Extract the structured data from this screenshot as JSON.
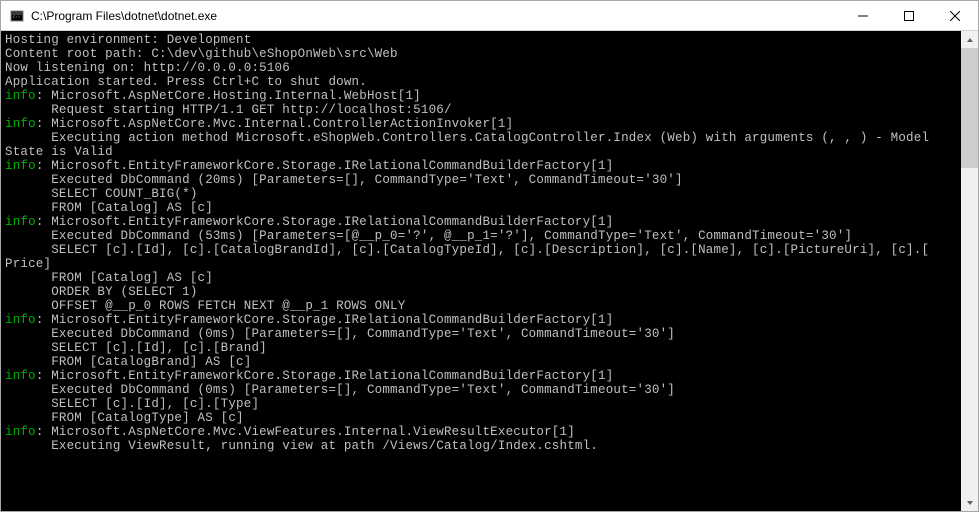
{
  "window": {
    "title": "C:\\Program Files\\dotnet\\dotnet.exe"
  },
  "log": {
    "l0": "Hosting environment: Development",
    "l1": "Content root path: C:\\dev\\github\\eShopOnWeb\\src\\Web",
    "l2": "Now listening on: http://0.0.0.0:5106",
    "l3": "Application started. Press Ctrl+C to shut down.",
    "i4": "info",
    "l4": ": Microsoft.AspNetCore.Hosting.Internal.WebHost[1]",
    "l5": "      Request starting HTTP/1.1 GET http://localhost:5106/",
    "i6": "info",
    "l6": ": Microsoft.AspNetCore.Mvc.Internal.ControllerActionInvoker[1]",
    "l7": "      Executing action method Microsoft.eShopWeb.Controllers.CatalogController.Index (Web) with arguments (, , ) - Model",
    "l8": "State is Valid",
    "i9": "info",
    "l9": ": Microsoft.EntityFrameworkCore.Storage.IRelationalCommandBuilderFactory[1]",
    "l10": "      Executed DbCommand (20ms) [Parameters=[], CommandType='Text', CommandTimeout='30']",
    "l11": "      SELECT COUNT_BIG(*)",
    "l12": "      FROM [Catalog] AS [c]",
    "i13": "info",
    "l13": ": Microsoft.EntityFrameworkCore.Storage.IRelationalCommandBuilderFactory[1]",
    "l14": "      Executed DbCommand (53ms) [Parameters=[@__p_0='?', @__p_1='?'], CommandType='Text', CommandTimeout='30']",
    "l15": "      SELECT [c].[Id], [c].[CatalogBrandId], [c].[CatalogTypeId], [c].[Description], [c].[Name], [c].[PictureUri], [c].[",
    "l16": "Price]",
    "l17": "      FROM [Catalog] AS [c]",
    "l18": "      ORDER BY (SELECT 1)",
    "l19": "      OFFSET @__p_0 ROWS FETCH NEXT @__p_1 ROWS ONLY",
    "i20": "info",
    "l20": ": Microsoft.EntityFrameworkCore.Storage.IRelationalCommandBuilderFactory[1]",
    "l21": "      Executed DbCommand (0ms) [Parameters=[], CommandType='Text', CommandTimeout='30']",
    "l22": "      SELECT [c].[Id], [c].[Brand]",
    "l23": "      FROM [CatalogBrand] AS [c]",
    "i24": "info",
    "l24": ": Microsoft.EntityFrameworkCore.Storage.IRelationalCommandBuilderFactory[1]",
    "l25": "      Executed DbCommand (0ms) [Parameters=[], CommandType='Text', CommandTimeout='30']",
    "l26": "      SELECT [c].[Id], [c].[Type]",
    "l27": "      FROM [CatalogType] AS [c]",
    "i28": "info",
    "l28": ": Microsoft.AspNetCore.Mvc.ViewFeatures.Internal.ViewResultExecutor[1]",
    "l29": "      Executing ViewResult, running view at path /Views/Catalog/Index.cshtml."
  }
}
